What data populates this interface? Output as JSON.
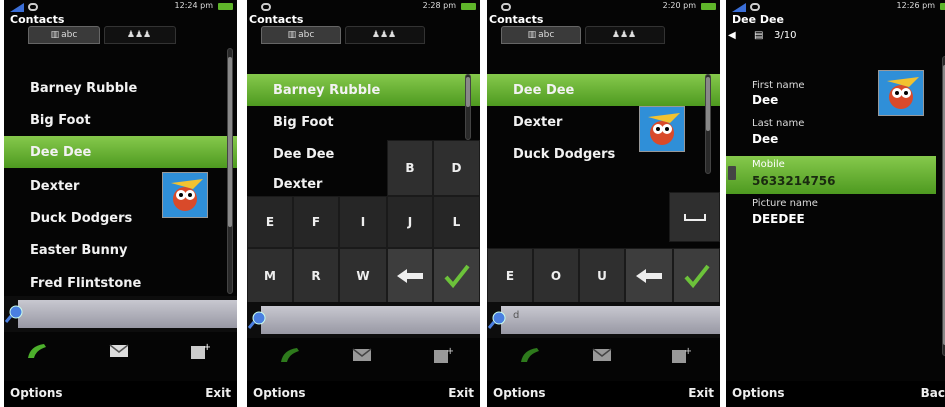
{
  "screens": [
    {
      "time": "12:24 pm",
      "title": "Contacts",
      "tabs": [
        {
          "label": "abc"
        },
        {
          "label": ""
        }
      ],
      "contacts": [
        "Barney Rubble",
        "Big Foot",
        "Dee Dee",
        "Dexter",
        "Duck Dodgers",
        "Easter Bunny",
        "Fred Flintstone"
      ],
      "selected": "Dee Dee",
      "search_query": "",
      "softkeys": {
        "left": "Options",
        "right": "Exit"
      }
    },
    {
      "time": "2:28 pm",
      "title": "Contacts",
      "tabs": [
        {
          "label": "abc"
        },
        {
          "label": ""
        }
      ],
      "contacts": [
        "Barney Rubble",
        "Big Foot",
        "Dee Dee",
        "Dexter"
      ],
      "selected": "Barney Rubble",
      "keys_row0": [
        "B",
        "D"
      ],
      "keys_row1": [
        "E",
        "F",
        "I",
        "J",
        "L"
      ],
      "keys_row2": [
        "M",
        "R",
        "W"
      ],
      "search_query": "",
      "softkeys": {
        "left": "Options",
        "right": "Exit"
      }
    },
    {
      "time": "2:20 pm",
      "title": "Contacts",
      "tabs": [
        {
          "label": "abc"
        },
        {
          "label": ""
        }
      ],
      "contacts": [
        "Dee Dee",
        "Dexter",
        "Duck Dodgers"
      ],
      "selected": "Dee Dee",
      "keys_row2": [
        "E",
        "O",
        "U"
      ],
      "search_query": "d",
      "softkeys": {
        "left": "Options",
        "right": "Exit"
      }
    },
    {
      "time": "12:26 pm",
      "title": "Dee Dee",
      "pager": "3/10",
      "fields": [
        {
          "label": "First name",
          "value": "Dee"
        },
        {
          "label": "Last name",
          "value": "Dee"
        },
        {
          "label": "Mobile",
          "value": "5633214756"
        },
        {
          "label": "Picture name",
          "value": "DEEDEE"
        }
      ],
      "softkeys": {
        "left": "Options",
        "right": "Back"
      }
    }
  ]
}
